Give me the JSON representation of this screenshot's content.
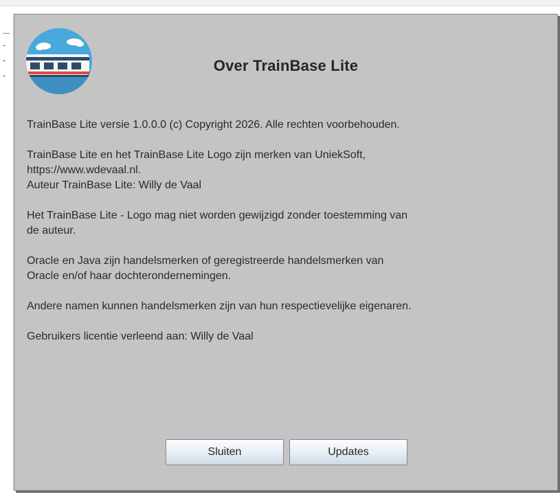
{
  "dialog": {
    "title": "Over TrainBase Lite",
    "paragraphs": {
      "p1": "TrainBase Lite versie 1.0.0.0 (c) Copyright 2026. Alle rechten voorbehouden.",
      "p2_line1": "TrainBase Lite en het TrainBase Lite Logo zijn merken van UniekSoft,",
      "p2_line2": "https://www.wdevaal.nl.",
      "p2_line3": "Auteur TrainBase Lite: Willy de Vaal",
      "p3_line1": "Het TrainBase Lite - Logo mag niet worden gewijzigd zonder toestemming van",
      "p3_line2": "de auteur.",
      "p4_line1": "Oracle en Java zijn handelsmerken of geregistreerde handelsmerken van",
      "p4_line2": "Oracle en/of haar dochterondernemingen.",
      "p5": "Andere namen kunnen handelsmerken zijn van hun respectievelijke eigenaren.",
      "p6": "Gebruikers licentie verleend aan: Willy de Vaal"
    },
    "buttons": {
      "close_label": "Sluiten",
      "updates_label": "Updates"
    },
    "logo_icon": "train-logo-icon",
    "colors": {
      "dialog_background": "#c4c4c4",
      "logo_circle": "#4aa6d8",
      "button_gradient_top": "#fdfdfe",
      "button_gradient_bottom": "#cfd9e4"
    }
  }
}
